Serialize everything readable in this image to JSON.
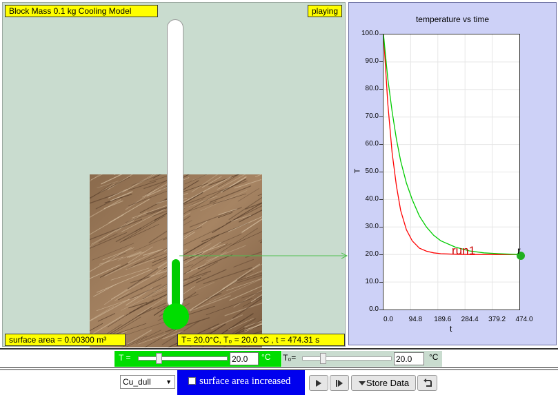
{
  "sim": {
    "title": "Block Mass 0.1 kg Cooling Model",
    "status": "playing",
    "surface_area": "surface area = 0.00300 m³",
    "readout": "T= 20.0°C, T₀ = 20.0 °C , t = 474.31 s",
    "thermometer_level": 0.19
  },
  "graph": {
    "title": "temperature vs time",
    "ylabel": "T",
    "xlabel": "t",
    "run_label": "run1",
    "y_ticks": [
      "100.0",
      "90.0",
      "80.0",
      "70.0",
      "60.0",
      "50.0",
      "40.0",
      "30.0",
      "20.0",
      "10.0",
      "0.0"
    ],
    "x_ticks": [
      "0.0",
      "94.8",
      "189.6",
      "284.4",
      "379.2",
      "474.0"
    ],
    "colors": {
      "run1": "#ff0000",
      "current": "#00cc00"
    }
  },
  "chart_data": {
    "type": "line",
    "title": "temperature vs time",
    "xlabel": "t",
    "ylabel": "T",
    "xlim": [
      0,
      474
    ],
    "ylim": [
      0,
      100
    ],
    "series": [
      {
        "name": "run1",
        "x": [
          0,
          15,
          30,
          45,
          60,
          80,
          100,
          125,
          150,
          175,
          200,
          250,
          300,
          350,
          400,
          474
        ],
        "y": [
          100,
          75,
          57,
          45,
          36,
          29,
          25,
          22.3,
          21.2,
          20.6,
          20.3,
          20.1,
          20,
          20,
          20,
          20
        ]
      },
      {
        "x": [
          0,
          15,
          30,
          45,
          60,
          80,
          100,
          125,
          150,
          175,
          200,
          250,
          300,
          350,
          400,
          474
        ],
        "y": [
          100,
          84,
          72,
          62,
          54,
          46,
          40,
          34,
          30,
          27,
          25,
          22.7,
          21.3,
          20.6,
          20.3,
          20
        ]
      }
    ]
  },
  "controls": {
    "temp_label": "T =",
    "temp_value": "20.0",
    "temp_unit": "°C",
    "temp_slider_level": 0.2,
    "t0_label": "T₀=",
    "t0_value": "20.0",
    "t0_unit": "°C",
    "t0_slider_level": 0.2,
    "material_selected": "Cu_dull",
    "checkbox_label": "surface area increased",
    "store_data": "Store Data"
  }
}
